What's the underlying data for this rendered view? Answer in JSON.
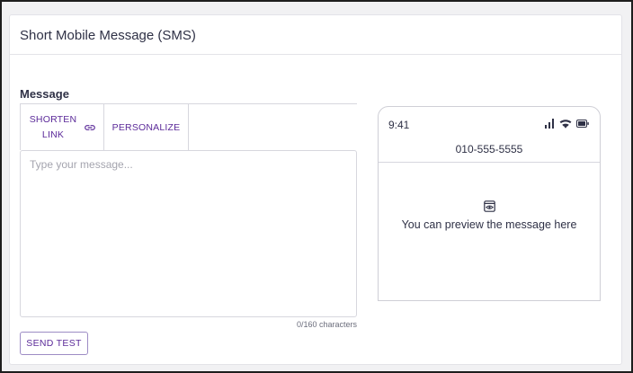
{
  "page": {
    "title": "Short Mobile Message (SMS)"
  },
  "message": {
    "label": "Message",
    "toolbar": {
      "shorten_link_label": "SHORTEN LINK",
      "personalize_label": "PERSONALIZE"
    },
    "placeholder": "Type your message...",
    "value": "",
    "char_count": "0/160 characters",
    "send_test_label": "SEND TEST"
  },
  "preview": {
    "time": "9:41",
    "phone_number": "010-555-5555",
    "placeholder_text": "You can preview the message here",
    "icons": [
      "signal-icon",
      "wifi-icon",
      "battery-icon",
      "eye-preview-icon"
    ]
  },
  "colors": {
    "accent": "#5b2a99",
    "text": "#2f3146",
    "border": "#d7d7de"
  }
}
